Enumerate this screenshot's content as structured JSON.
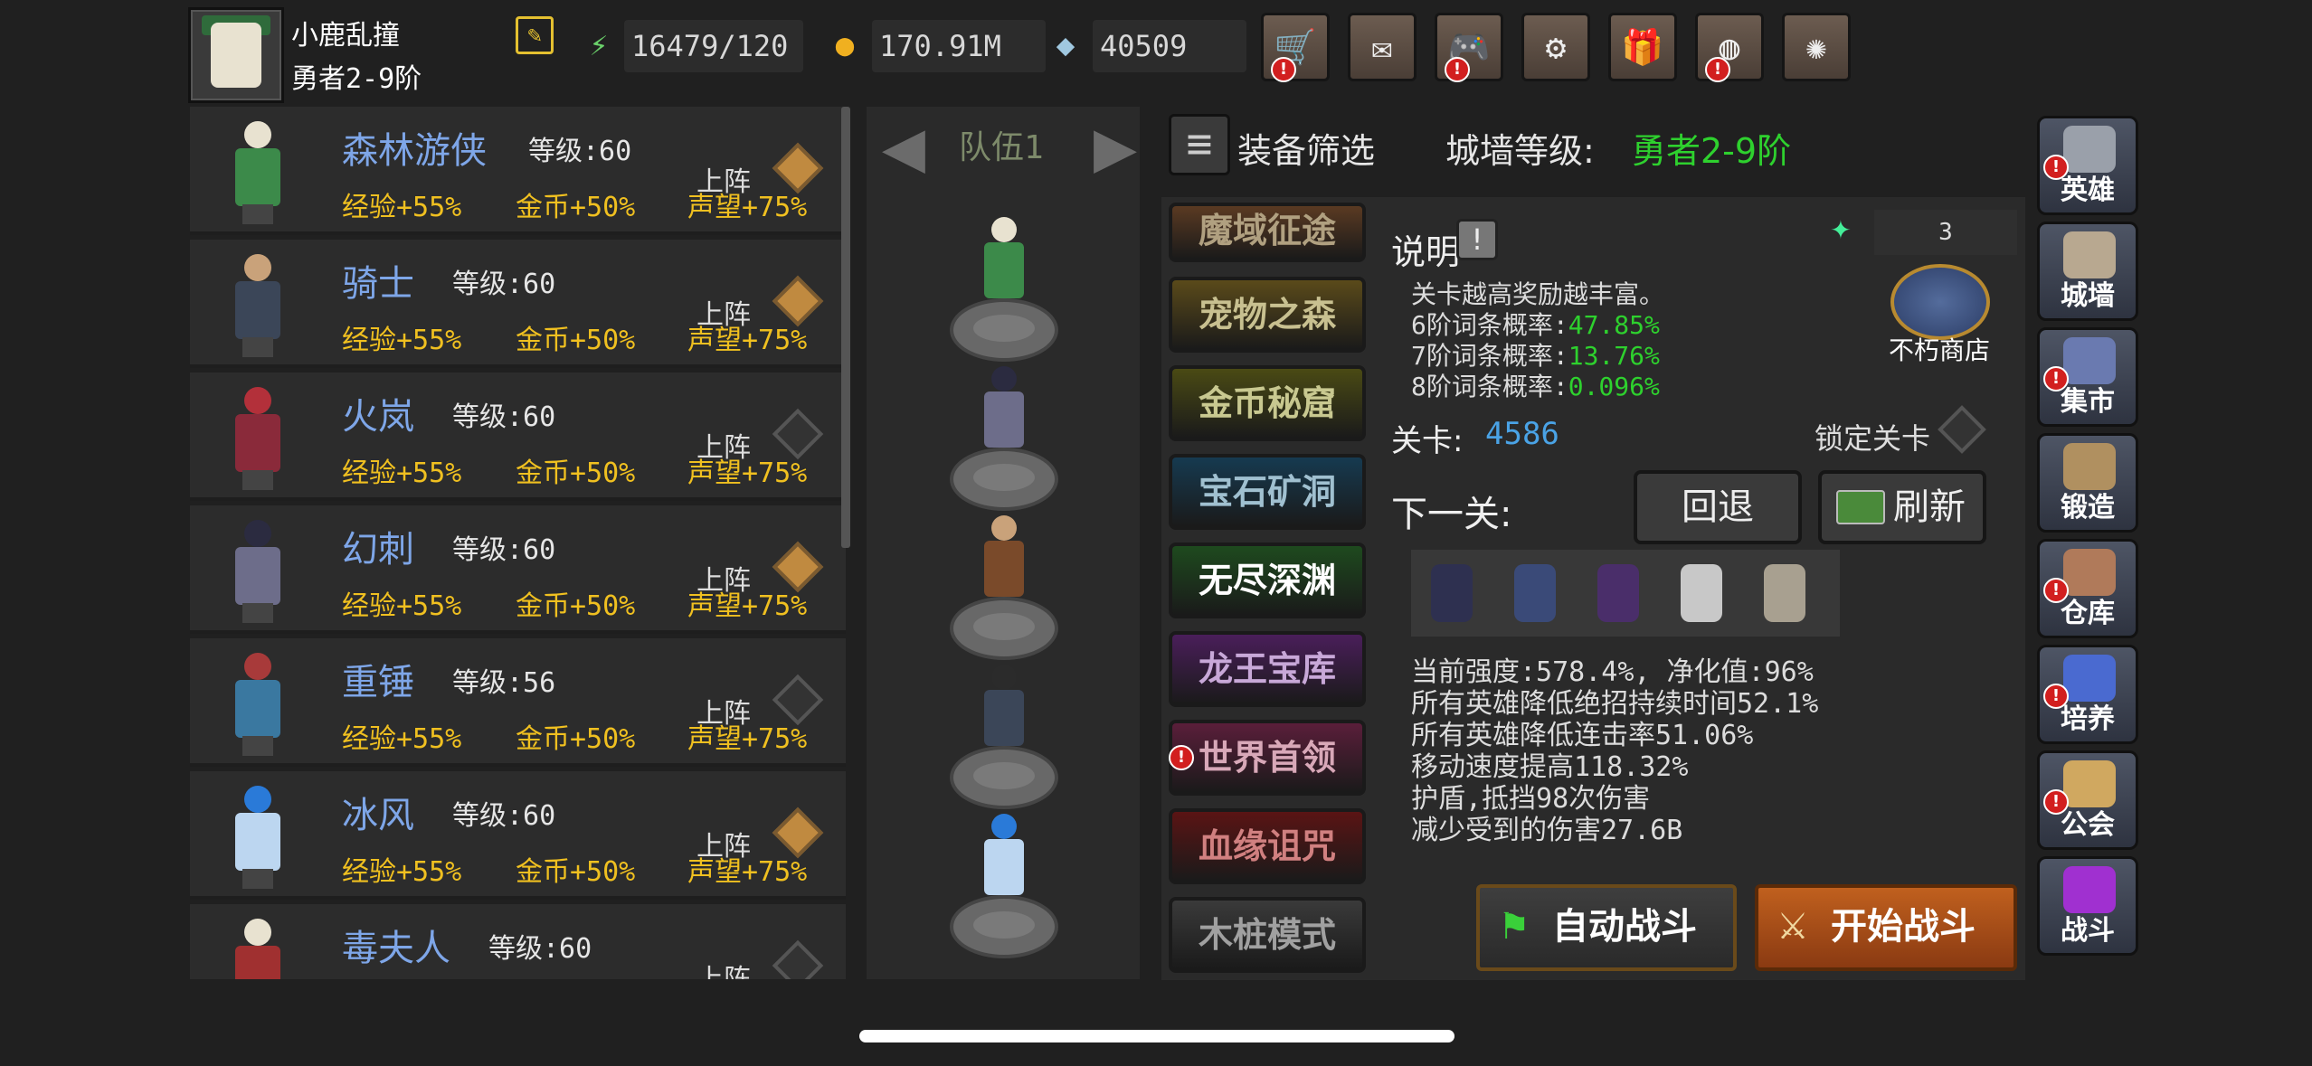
{
  "player": {
    "name": "小鹿乱撞",
    "rank": "勇者2-9阶"
  },
  "resources": {
    "energy": "16479/120",
    "gold": "170.91M",
    "gems": "40509"
  },
  "top_buttons": [
    {
      "icon": "cart-icon",
      "glyph": "🛒",
      "badge": "!"
    },
    {
      "icon": "mail-icon",
      "glyph": "✉",
      "badge": ""
    },
    {
      "icon": "gamepad-icon",
      "glyph": "🎮",
      "badge": "!"
    },
    {
      "icon": "gear-icon",
      "glyph": "⚙",
      "badge": ""
    },
    {
      "icon": "gift-icon",
      "glyph": "🎁",
      "badge": ""
    },
    {
      "icon": "wheel-icon",
      "glyph": "◍",
      "badge": "!"
    },
    {
      "icon": "fireworks-icon",
      "glyph": "✺",
      "badge": ""
    }
  ],
  "heroes": [
    {
      "name": "森林游侠",
      "level": "等级:60",
      "exp": "经验+55%",
      "gold": "金币+50%",
      "fame": "声望+75%",
      "deploy": "上阵",
      "deployed": true,
      "color": "#3c8a4a",
      "head": "#e8e2d0"
    },
    {
      "name": "骑士",
      "level": "等级:60",
      "exp": "经验+55%",
      "gold": "金币+50%",
      "fame": "声望+75%",
      "deploy": "上阵",
      "deployed": true,
      "color": "#3b4658",
      "head": "#c9a27a"
    },
    {
      "name": "火岚",
      "level": "等级:60",
      "exp": "经验+55%",
      "gold": "金币+50%",
      "fame": "声望+75%",
      "deploy": "上阵",
      "deployed": false,
      "color": "#8a2a3a",
      "head": "#b3303a"
    },
    {
      "name": "幻刺",
      "level": "等级:60",
      "exp": "经验+55%",
      "gold": "金币+50%",
      "fame": "声望+75%",
      "deploy": "上阵",
      "deployed": true,
      "color": "#6d6d8a",
      "head": "#2b2b40"
    },
    {
      "name": "重锤",
      "level": "等级:56",
      "exp": "经验+55%",
      "gold": "金币+50%",
      "fame": "声望+75%",
      "deploy": "上阵",
      "deployed": false,
      "color": "#3a78a0",
      "head": "#a83a3a"
    },
    {
      "name": "冰风",
      "level": "等级:60",
      "exp": "经验+55%",
      "gold": "金币+50%",
      "fame": "声望+75%",
      "deploy": "上阵",
      "deployed": true,
      "color": "#bcd6f0",
      "head": "#2a7ad8"
    },
    {
      "name": "毒夫人",
      "level": "等级:60",
      "exp": "",
      "gold": "",
      "fame": "",
      "deploy": "上阵",
      "deployed": false,
      "color": "#a03030",
      "head": "#e8e2d0"
    }
  ],
  "team": {
    "label": "队伍1",
    "members": [
      {
        "color": "#3c8a4a",
        "head": "#e8e2d0"
      },
      {
        "color": "#6d6d8a",
        "head": "#2b2b40"
      },
      {
        "color": "#7a4a2a",
        "head": "#c9a27a"
      },
      {
        "color": "#3b4658",
        "head": "#2b2b2b"
      },
      {
        "color": "#bcd6f0",
        "head": "#2a7ad8"
      }
    ]
  },
  "filter_label": "装备筛选",
  "wall_level": {
    "label": "城墙等级:",
    "value": "勇者2-9阶"
  },
  "modes": [
    {
      "label": "魔域征途",
      "bg": "#5a3a22",
      "fg": "#b0a080",
      "badge": ""
    },
    {
      "label": "宠物之森",
      "bg": "#5a4a1a",
      "fg": "#c8c090",
      "badge": ""
    },
    {
      "label": "金币秘窟",
      "bg": "#4a4a14",
      "fg": "#c8c890",
      "badge": ""
    },
    {
      "label": "宝石矿洞",
      "bg": "#163a50",
      "fg": "#a0c0d0",
      "badge": ""
    },
    {
      "label": "无尽深渊",
      "bg": "#1e4a1e",
      "fg": "#ffffff",
      "badge": ""
    },
    {
      "label": "龙王宝库",
      "bg": "#4a1e5a",
      "fg": "#c8a8d8",
      "badge": ""
    },
    {
      "label": "世界首领",
      "bg": "#5a1e3a",
      "fg": "#d8a8b8",
      "badge": "!"
    },
    {
      "label": "血缘诅咒",
      "bg": "#5a1414",
      "fg": "#d08080",
      "badge": ""
    },
    {
      "label": "木桩模式",
      "bg": "#3a3a3a",
      "fg": "#a0a0a0",
      "badge": ""
    }
  ],
  "description": {
    "label": "说明",
    "text": "关卡越高奖励越丰富。",
    "probabilities": [
      {
        "label": "6阶词条概率:",
        "value": "47.85%"
      },
      {
        "label": "7阶词条概率:",
        "value": "13.76%"
      },
      {
        "label": "8阶词条概率:",
        "value": "0.096%"
      }
    ]
  },
  "count": "3",
  "shop_label": "不朽商店",
  "stage": {
    "label": "关卡:",
    "value": "4586"
  },
  "lock_label": "锁定关卡",
  "next_label": "下一关:",
  "back_label": "回退",
  "refresh_label": "刷新",
  "enemies": [
    "shadow-demon",
    "reaper",
    "tome",
    "skeleton-beast",
    "skeleton-warrior"
  ],
  "info_lines": [
    "当前强度:578.4%, 净化值:96%",
    "所有英雄降低绝招持续时间52.1%",
    "所有英雄降低连击率51.06%",
    "移动速度提高118.32%",
    "护盾,抵挡98次伤害",
    "减少受到的伤害27.6B"
  ],
  "auto_battle": "自动战斗",
  "start_battle": "开始战斗",
  "nav": [
    {
      "label": "英雄",
      "icon": "helmet-icon",
      "color": "#9aa0aa",
      "badge": "!"
    },
    {
      "label": "城墙",
      "icon": "castle-wall-icon",
      "color": "#b8a890",
      "badge": ""
    },
    {
      "label": "集市",
      "icon": "market-icon",
      "color": "#6a7ab0",
      "badge": "!"
    },
    {
      "label": "锻造",
      "icon": "anvil-icon",
      "color": "#b09060",
      "badge": ""
    },
    {
      "label": "仓库",
      "icon": "warehouse-icon",
      "color": "#b07a5a",
      "badge": "!"
    },
    {
      "label": "培养",
      "icon": "chalice-icon",
      "color": "#4a6ad0",
      "badge": "!"
    },
    {
      "label": "公会",
      "icon": "guild-icon",
      "color": "#d0a860",
      "badge": "!"
    },
    {
      "label": "战斗",
      "icon": "portal-icon",
      "color": "#a030d0",
      "badge": ""
    }
  ]
}
